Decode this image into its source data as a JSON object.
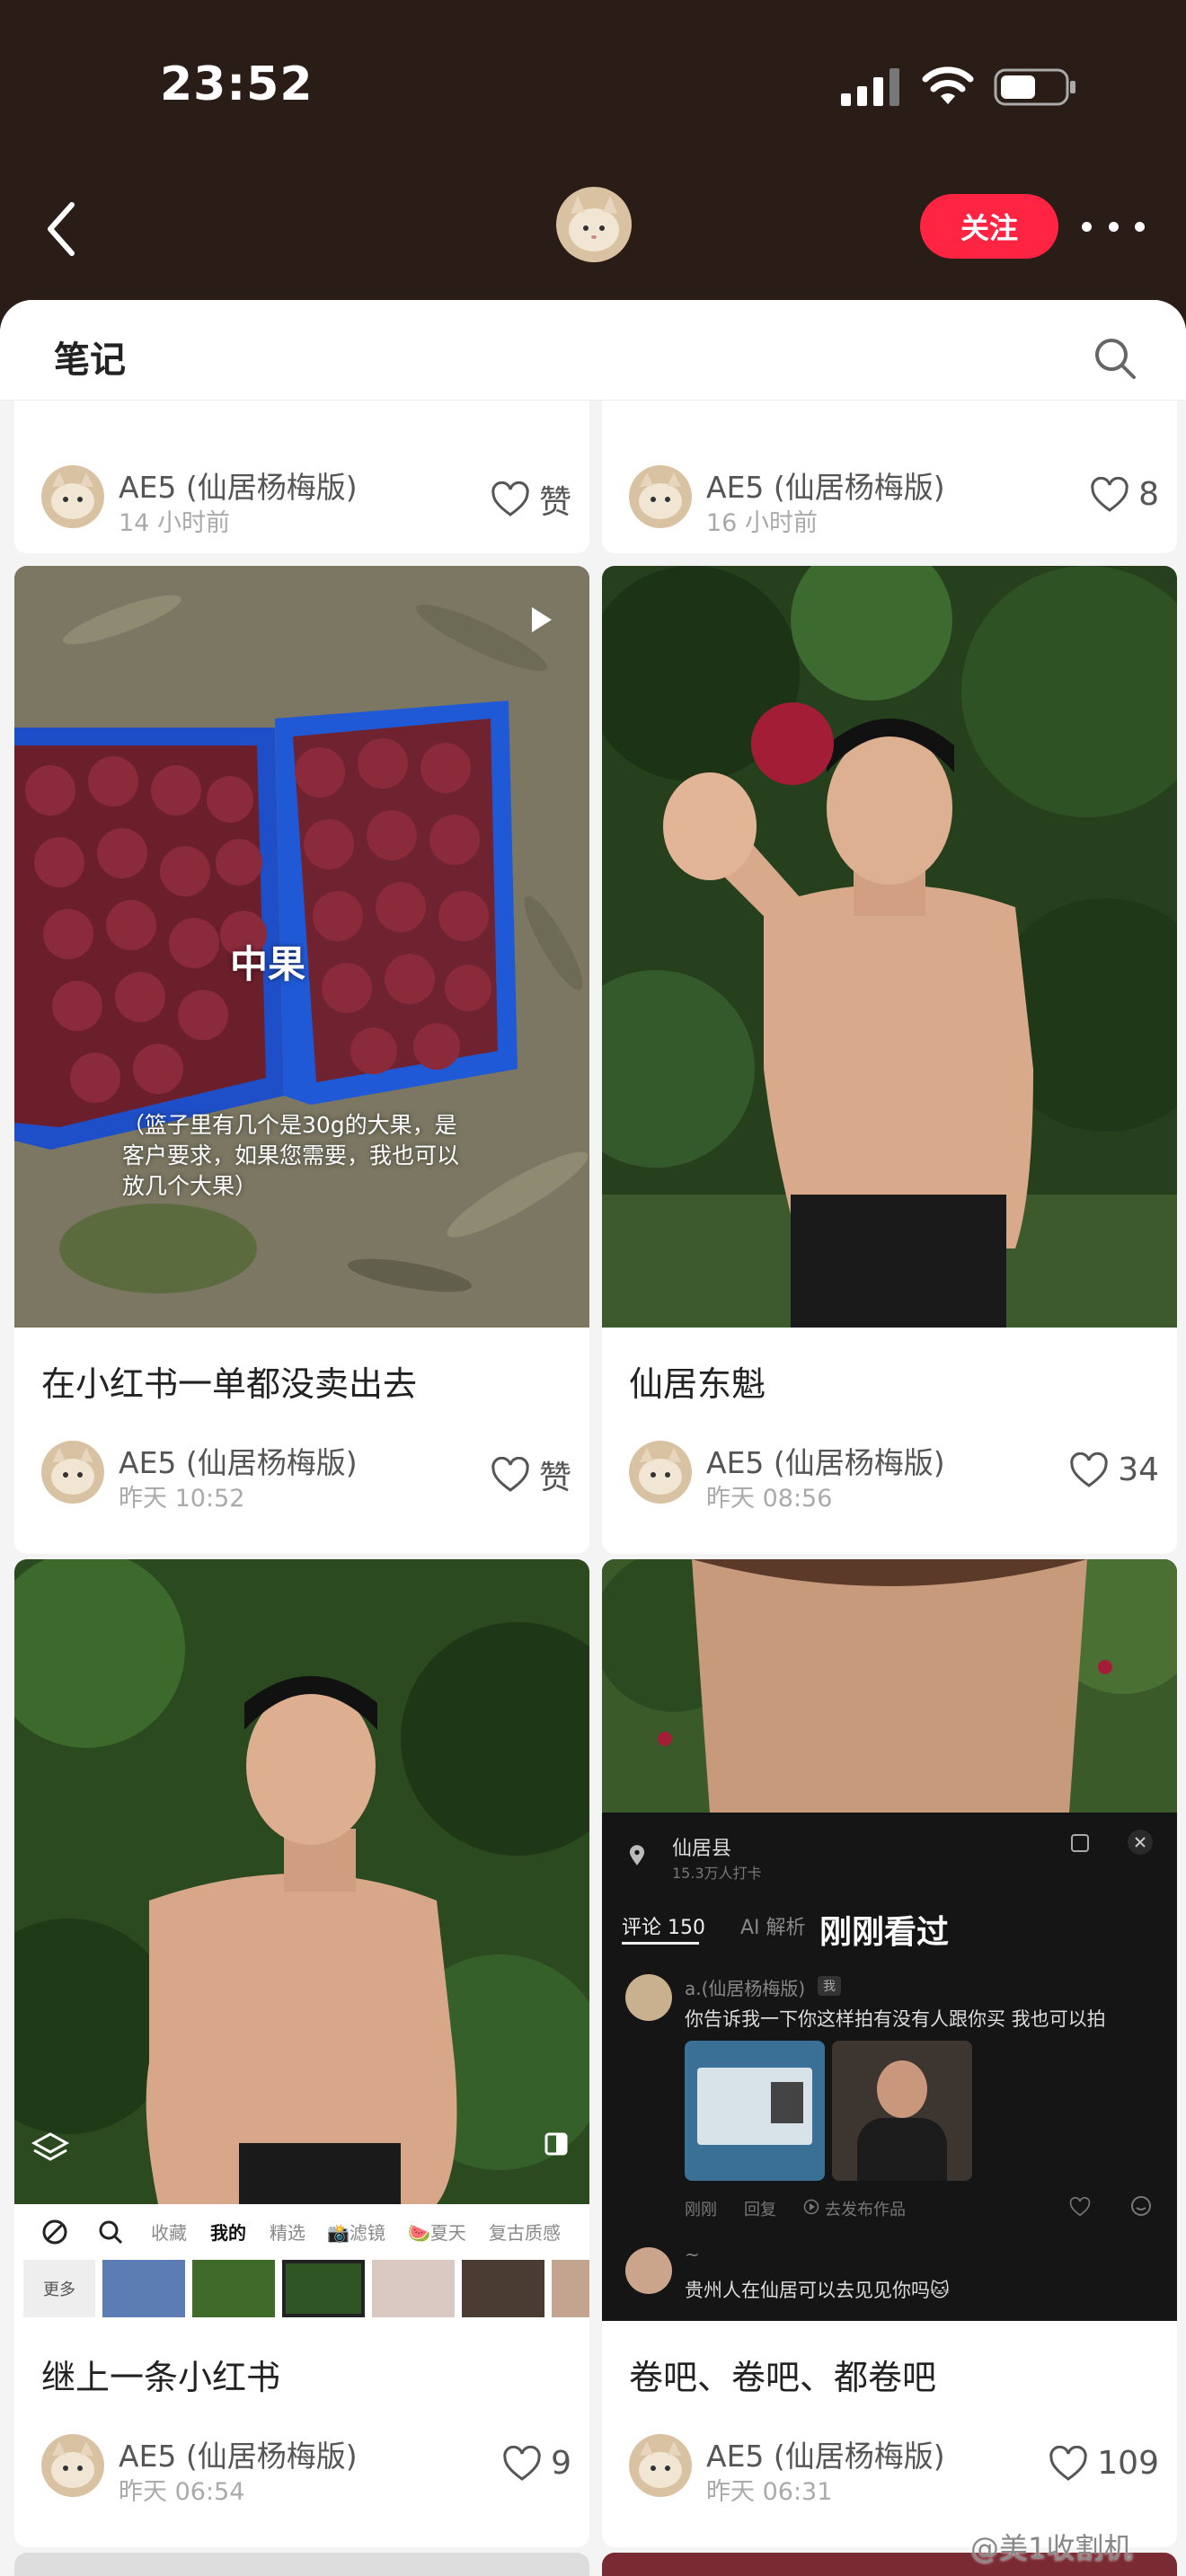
{
  "status": {
    "time": "23:52"
  },
  "header": {
    "follow_label": "关注"
  },
  "sheet": {
    "title": "笔记"
  },
  "cards": [
    {
      "title": "",
      "author": "AE5 (仙居杨梅版)",
      "time": "14 小时前",
      "likes": "赞"
    },
    {
      "title": "",
      "author": "AE5 (仙居杨梅版)",
      "time": "16 小时前",
      "likes": "8"
    },
    {
      "title": "在小红书一单都没卖出去",
      "author": "AE5 (仙居杨梅版)",
      "time": "昨天 10:52",
      "likes": "赞",
      "overlay_main": "中果",
      "overlay_sub": "（篮子里有几个是30g的大果，是客户要求，如果您需要，我也可以放几个大果）"
    },
    {
      "title": "仙居东魁",
      "author": "AE5 (仙居杨梅版)",
      "time": "昨天 08:56",
      "likes": "34"
    },
    {
      "title": "继上一条小红书",
      "author": "AE5 (仙居杨梅版)",
      "time": "昨天 06:54",
      "likes": "9",
      "editor_tabs": [
        "收藏",
        "我的",
        "精选",
        "📸滤镜",
        "🍉夏天",
        "复古质感"
      ],
      "editor_more": "更多"
    },
    {
      "title": "卷吧、卷吧、都卷吧",
      "author": "AE5 (仙居杨梅版)",
      "time": "昨天 06:31",
      "likes": "109",
      "location_name": "仙居县",
      "location_sub": "15.3万人打卡",
      "comment_tab": "评论 150",
      "ai_tab": "AI 解析",
      "recent_label": "刚刚看过",
      "comment1_user": "a.(仙居杨梅版)",
      "comment1_badge": "我",
      "comment1_text": "你告诉我一下你这样拍有没有人跟你买 我也可以拍",
      "comment1_time": "刚刚",
      "comment1_reply": "回复",
      "comment1_publish": "去发布作品",
      "comment2_user": "~",
      "comment2_text": "贵州人在仙居可以去见见你吗🐱"
    }
  ],
  "watermark": "@美1收割机"
}
